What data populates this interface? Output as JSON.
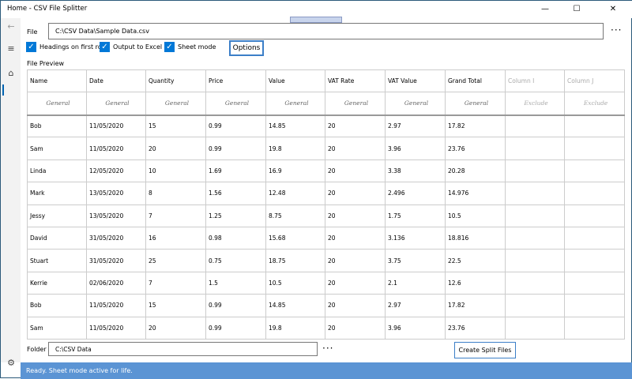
{
  "window": {
    "title": "Home - CSV File Splitter"
  },
  "file": {
    "label": "File",
    "value": "C:\\CSV Data\\Sample Data.csv",
    "browse": "···"
  },
  "options": {
    "headings": "Headings on first row",
    "excel": "Output to Excel",
    "sheet": "Sheet mode",
    "button": "Options"
  },
  "preview": {
    "label": "File Preview",
    "headers": [
      "Name",
      "Date",
      "Quantity",
      "Price",
      "Value",
      "VAT Rate",
      "VAT Value",
      "Grand Total",
      "Column I",
      "Column J"
    ],
    "formats": [
      "General",
      "General",
      "General",
      "General",
      "General",
      "General",
      "General",
      "General",
      "Exclude",
      "Exclude"
    ],
    "rows": [
      [
        "Bob",
        "11/05/2020",
        "15",
        "0.99",
        "14.85",
        "20",
        "2.97",
        "17.82",
        "",
        ""
      ],
      [
        "Sam",
        "11/05/2020",
        "20",
        "0.99",
        "19.8",
        "20",
        "3.96",
        "23.76",
        "",
        ""
      ],
      [
        "Linda",
        "12/05/2020",
        "10",
        "1.69",
        "16.9",
        "20",
        "3.38",
        "20.28",
        "",
        ""
      ],
      [
        "Mark",
        "13/05/2020",
        "8",
        "1.56",
        "12.48",
        "20",
        "2.496",
        "14.976",
        "",
        ""
      ],
      [
        "Jessy",
        "13/05/2020",
        "7",
        "1.25",
        "8.75",
        "20",
        "1.75",
        "10.5",
        "",
        ""
      ],
      [
        "David",
        "31/05/2020",
        "16",
        "0.98",
        "15.68",
        "20",
        "3.136",
        "18.816",
        "",
        ""
      ],
      [
        "Stuart",
        "31/05/2020",
        "25",
        "0.75",
        "18.75",
        "20",
        "3.75",
        "22.5",
        "",
        ""
      ],
      [
        "Kerrie",
        "02/06/2020",
        "7",
        "1.5",
        "10.5",
        "20",
        "2.1",
        "12.6",
        "",
        ""
      ],
      [
        "Bob",
        "11/05/2020",
        "15",
        "0.99",
        "14.85",
        "20",
        "2.97",
        "17.82",
        "",
        ""
      ],
      [
        "Sam",
        "11/05/2020",
        "20",
        "0.99",
        "19.8",
        "20",
        "3.96",
        "23.76",
        "",
        ""
      ]
    ]
  },
  "folder": {
    "label": "Folder",
    "value": "C:\\CSV Data",
    "browse": "···"
  },
  "actions": {
    "create": "Create Split Files"
  },
  "status": "Ready.  Sheet mode active for life."
}
